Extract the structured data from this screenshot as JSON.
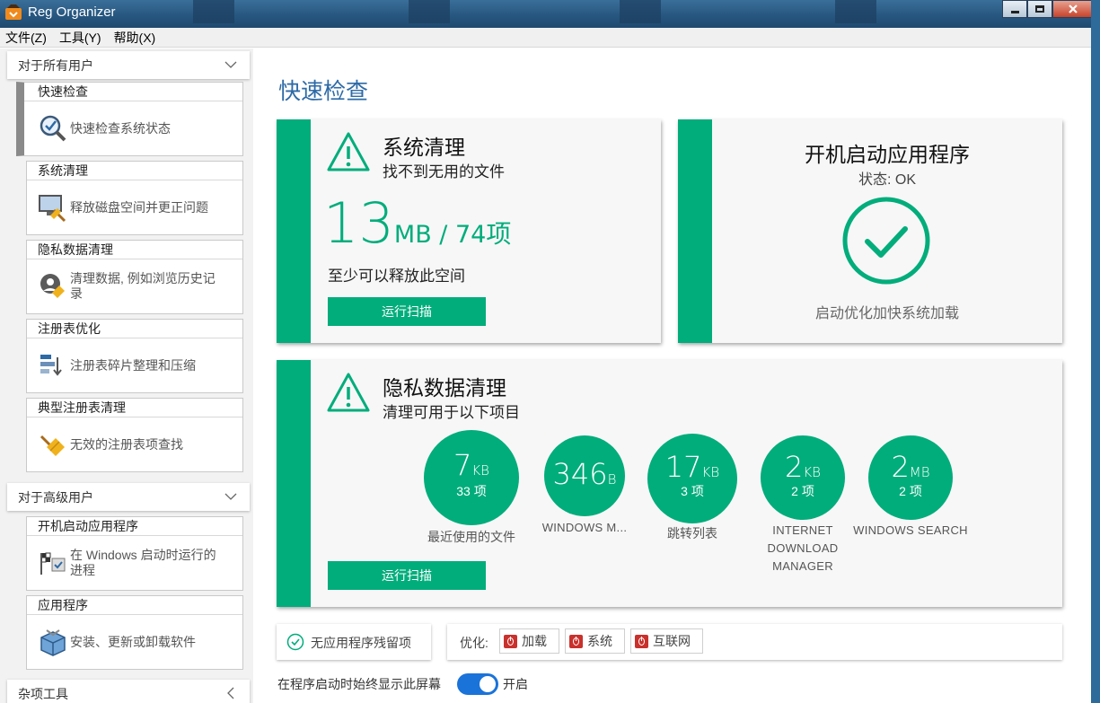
{
  "window": {
    "title": "Reg Organizer"
  },
  "menu": [
    "文件(Z)",
    "工具(Y)",
    "帮助(X)"
  ],
  "sidebar": {
    "section_all_users": "对于所有用户",
    "section_advanced": "对于高级用户",
    "section_misc": "杂项工具",
    "items": [
      {
        "title": "快速检查",
        "desc": "快速检查系统状态"
      },
      {
        "title": "系统清理",
        "desc": "释放磁盘空间并更正问题"
      },
      {
        "title": "隐私数据清理",
        "desc": "清理数据, 例如浏览历史记录"
      },
      {
        "title": "注册表优化",
        "desc": "注册表碎片整理和压缩"
      },
      {
        "title": "典型注册表清理",
        "desc": "无效的注册表项查找"
      },
      {
        "title": "开机启动应用程序",
        "desc": "在 Windows 启动时运行的进程"
      },
      {
        "title": "应用程序",
        "desc": "安装、更新或卸载软件"
      }
    ]
  },
  "main": {
    "page_title": "快速检查",
    "cleanup": {
      "title": "系统清理",
      "subtitle": "找不到无用的文件",
      "size_value": "13",
      "size_unit": "MB / 74",
      "items_word": "项",
      "note": "至少可以释放此空间",
      "button": "运行扫描"
    },
    "startup": {
      "title": "开机启动应用程序",
      "status": "状态: OK",
      "caption": "启动优化加快系统加载"
    },
    "privacy": {
      "title": "隐私数据清理",
      "subtitle": "清理可用于以下项目",
      "button": "运行扫描",
      "items": [
        {
          "value": "7",
          "unit": "KB",
          "count": "33 项",
          "label": "最近使用的文件"
        },
        {
          "value": "346",
          "unit": "B",
          "count": "",
          "label": "WINDOWS M..."
        },
        {
          "value": "17",
          "unit": "KB",
          "count": "3 项",
          "label": "跳转列表"
        },
        {
          "value": "2",
          "unit": "KB",
          "count": "2 项",
          "label": "INTERNET DOWNLOAD MANAGER"
        },
        {
          "value": "2",
          "unit": "MB",
          "count": "2 项",
          "label": "WINDOWS SEARCH"
        }
      ]
    },
    "bottom": {
      "no_residue": "无应用程序残留项",
      "optimize_label": "优化:",
      "chips": [
        "加载",
        "系统",
        "互联网"
      ],
      "startup_text": "在程序启动时始终显示此屏幕",
      "toggle_label": "开启",
      "toggle_on": true
    }
  },
  "colors": {
    "accent": "#00ad7b",
    "title_blue": "#2d6aa6",
    "toggle": "#1a73d9",
    "power": "#c9312c"
  }
}
